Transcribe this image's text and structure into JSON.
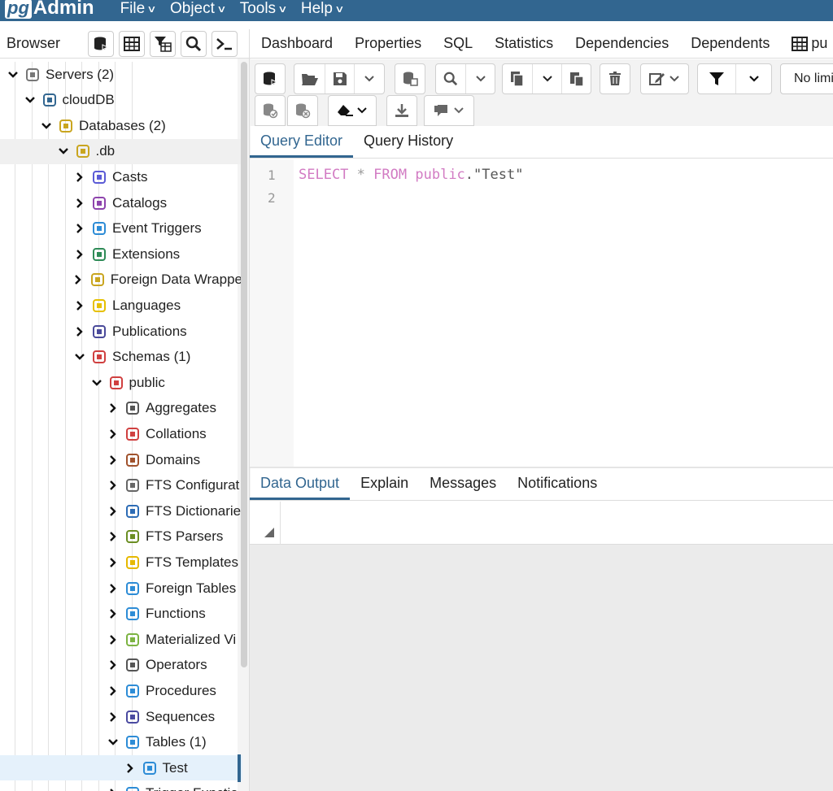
{
  "app": {
    "logo_pg": "pg",
    "logo_admin": "Admin"
  },
  "menu": [
    {
      "label": "File"
    },
    {
      "label": "Object"
    },
    {
      "label": "Tools"
    },
    {
      "label": "Help"
    }
  ],
  "browser": {
    "title": "Browser",
    "tree": [
      {
        "label": "Servers (2)",
        "depth": 0,
        "expanded": true,
        "icon": "servers-icon"
      },
      {
        "label": "cloudDB",
        "depth": 1,
        "expanded": true,
        "icon": "postgres-elephant-icon"
      },
      {
        "label": "Databases (2)",
        "depth": 2,
        "expanded": true,
        "icon": "databases-icon"
      },
      {
        "label": ".db",
        "depth": 3,
        "expanded": true,
        "icon": "database-icon"
      },
      {
        "label": "Casts",
        "depth": 4,
        "expanded": false,
        "icon": "casts-icon"
      },
      {
        "label": "Catalogs",
        "depth": 4,
        "expanded": false,
        "icon": "catalogs-icon"
      },
      {
        "label": "Event Triggers",
        "depth": 4,
        "expanded": false,
        "icon": "event-triggers-icon"
      },
      {
        "label": "Extensions",
        "depth": 4,
        "expanded": false,
        "icon": "extensions-icon"
      },
      {
        "label": "Foreign Data Wrappe",
        "depth": 4,
        "expanded": false,
        "icon": "foreign-data-wrappers-icon"
      },
      {
        "label": "Languages",
        "depth": 4,
        "expanded": false,
        "icon": "languages-icon"
      },
      {
        "label": "Publications",
        "depth": 4,
        "expanded": false,
        "icon": "publications-icon"
      },
      {
        "label": "Schemas (1)",
        "depth": 4,
        "expanded": true,
        "icon": "schemas-icon"
      },
      {
        "label": "public",
        "depth": 5,
        "expanded": true,
        "icon": "schema-icon"
      },
      {
        "label": "Aggregates",
        "depth": 6,
        "expanded": false,
        "icon": "aggregates-icon"
      },
      {
        "label": "Collations",
        "depth": 6,
        "expanded": false,
        "icon": "collations-icon"
      },
      {
        "label": "Domains",
        "depth": 6,
        "expanded": false,
        "icon": "domains-icon"
      },
      {
        "label": "FTS Configurat",
        "depth": 6,
        "expanded": false,
        "icon": "fts-configurations-icon"
      },
      {
        "label": "FTS Dictionarie",
        "depth": 6,
        "expanded": false,
        "icon": "fts-dictionaries-icon"
      },
      {
        "label": "FTS Parsers",
        "depth": 6,
        "expanded": false,
        "icon": "fts-parsers-icon"
      },
      {
        "label": "FTS Templates",
        "depth": 6,
        "expanded": false,
        "icon": "fts-templates-icon"
      },
      {
        "label": "Foreign Tables",
        "depth": 6,
        "expanded": false,
        "icon": "foreign-tables-icon"
      },
      {
        "label": "Functions",
        "depth": 6,
        "expanded": false,
        "icon": "functions-icon"
      },
      {
        "label": "Materialized Vi",
        "depth": 6,
        "expanded": false,
        "icon": "materialized-views-icon"
      },
      {
        "label": "Operators",
        "depth": 6,
        "expanded": false,
        "icon": "operators-icon"
      },
      {
        "label": "Procedures",
        "depth": 6,
        "expanded": false,
        "icon": "procedures-icon"
      },
      {
        "label": "Sequences",
        "depth": 6,
        "expanded": false,
        "icon": "sequences-icon"
      },
      {
        "label": "Tables (1)",
        "depth": 6,
        "expanded": true,
        "icon": "tables-icon"
      },
      {
        "label": "Test",
        "depth": 7,
        "expanded": false,
        "icon": "table-icon"
      },
      {
        "label": "Trigger Functio",
        "depth": 6,
        "expanded": false,
        "icon": "trigger-functions-icon"
      }
    ]
  },
  "main_tabs": [
    {
      "label": "Dashboard"
    },
    {
      "label": "Properties"
    },
    {
      "label": "SQL"
    },
    {
      "label": "Statistics"
    },
    {
      "label": "Dependencies"
    },
    {
      "label": "Dependents"
    },
    {
      "label": "pu"
    }
  ],
  "toolbar": {
    "limit_label": "No limi"
  },
  "query_tabs": [
    {
      "label": "Query Editor",
      "active": true
    },
    {
      "label": "Query History",
      "active": false
    }
  ],
  "editor": {
    "line_numbers": [
      "1",
      "2"
    ],
    "tokens": {
      "select": "SELECT",
      "star": "*",
      "from": "FROM",
      "schema": "public",
      "dot": ".",
      "table": "\"Test\""
    }
  },
  "output_tabs": [
    {
      "label": "Data Output",
      "active": true
    },
    {
      "label": "Explain",
      "active": false
    },
    {
      "label": "Messages",
      "active": false
    },
    {
      "label": "Notifications",
      "active": false
    }
  ],
  "colors": {
    "brand": "#326690",
    "keyword": "#d27bc3"
  }
}
